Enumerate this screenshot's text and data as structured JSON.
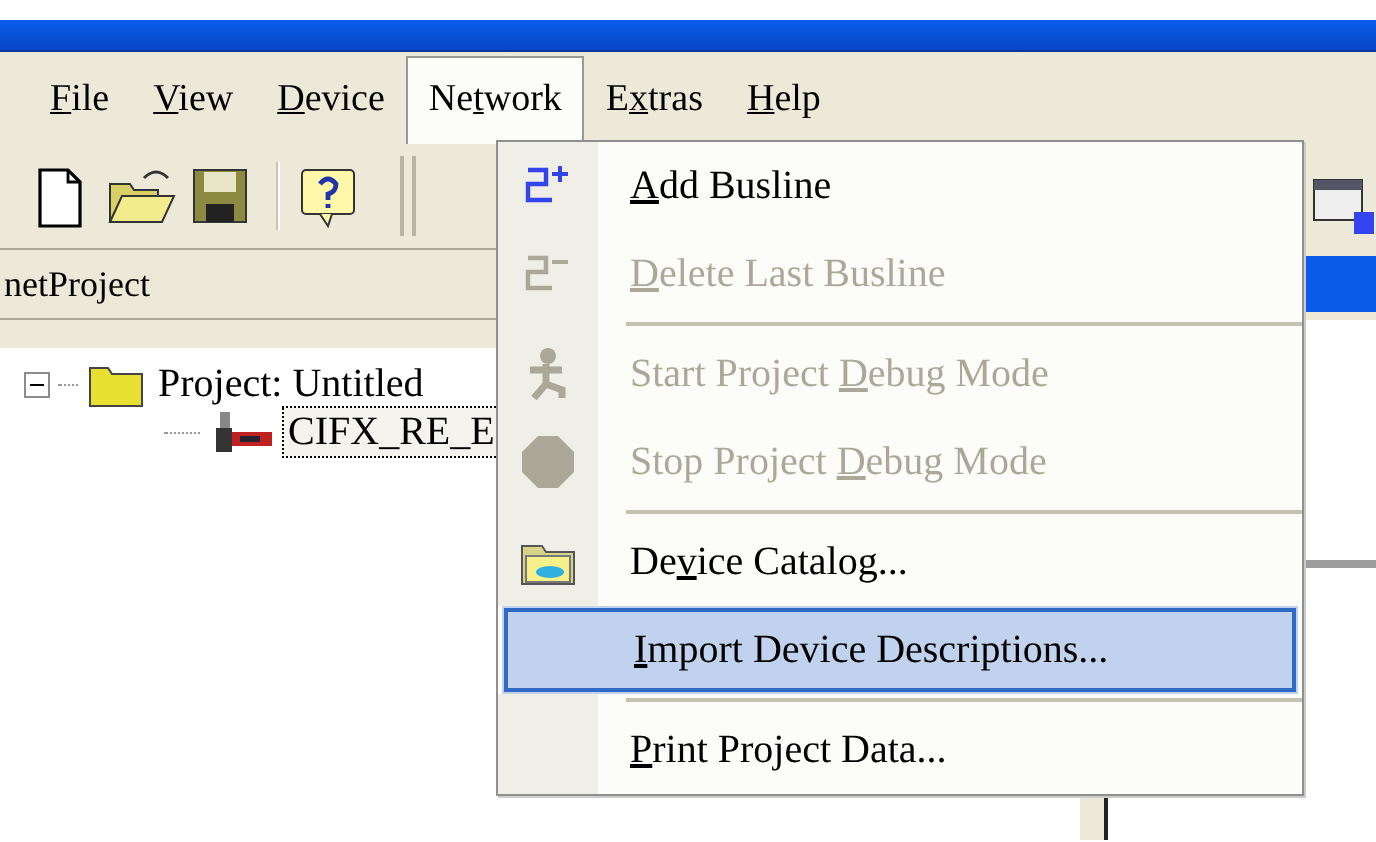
{
  "menubar": [
    {
      "key": "F",
      "after": "ile",
      "selected": false
    },
    {
      "key": "V",
      "after": "iew",
      "selected": false
    },
    {
      "key": "D",
      "after": "evice",
      "selected": false
    },
    {
      "before": "Ne",
      "key": "t",
      "after": "work",
      "selected": true
    },
    {
      "before": "E",
      "key": "x",
      "after": "tras",
      "selected": false
    },
    {
      "key": "H",
      "after": "elp",
      "selected": false
    }
  ],
  "panel": {
    "title": "netProject"
  },
  "tree": [
    {
      "label": "Project: Untitled",
      "expanded": true,
      "focused": false,
      "children": [
        {
          "label": "CIFX_RE_E",
          "focused": true
        }
      ]
    }
  ],
  "network_menu": [
    {
      "kind": "item",
      "key": "A",
      "after": "dd Busline",
      "disabled": false,
      "selected": false
    },
    {
      "kind": "item",
      "key": "D",
      "after": "elete Last Busline",
      "disabled": true,
      "selected": false
    },
    {
      "kind": "separator"
    },
    {
      "kind": "item",
      "before": "Start Project ",
      "key": "D",
      "after": "ebug Mode",
      "disabled": true,
      "selected": false
    },
    {
      "kind": "item",
      "before": "Stop Project ",
      "key": "D",
      "after": "ebug Mode",
      "disabled": true,
      "selected": false
    },
    {
      "kind": "separator"
    },
    {
      "kind": "item",
      "before": "De",
      "key": "v",
      "after": "ice Catalog...",
      "disabled": false,
      "selected": false
    },
    {
      "kind": "item",
      "key": "I",
      "after": "mport Device Descriptions...",
      "disabled": false,
      "selected": true
    },
    {
      "kind": "separator"
    },
    {
      "kind": "item",
      "key": "P",
      "after": "rint Project Data...",
      "disabled": false,
      "selected": false
    }
  ]
}
